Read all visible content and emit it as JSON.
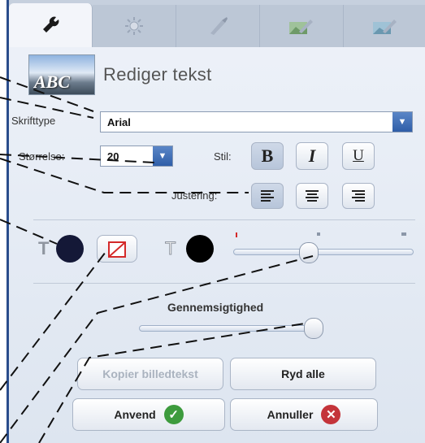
{
  "tabs": [
    {
      "name": "wrench",
      "active": true
    },
    {
      "name": "brightness",
      "active": false
    },
    {
      "name": "brush",
      "active": false
    },
    {
      "name": "landscape-brush",
      "active": false
    },
    {
      "name": "image-brush",
      "active": false
    }
  ],
  "header": {
    "thumb_text": "ABC",
    "title": "Rediger tekst"
  },
  "font": {
    "label": "Skrifttype",
    "value": "Arial"
  },
  "size": {
    "label": "Størrelse:",
    "value": "20"
  },
  "style": {
    "label": "Stil:",
    "bold": "B",
    "italic": "I",
    "underline": "U",
    "bold_active": true
  },
  "justify": {
    "label": "Justering:",
    "active": "left"
  },
  "colors": {
    "text_color": "#141837",
    "bg_color": "#000000",
    "accent": "#2f5ea8",
    "none_red": "#d42a2a"
  },
  "opacity": {
    "label": "Gennemsigtighed",
    "value": 0.97
  },
  "shadow_slider": {
    "value": 0.42
  },
  "buttons": {
    "copy": "Kopier billedtekst",
    "clear": "Ryd alle",
    "apply": "Anvend",
    "cancel": "Annuller"
  },
  "icons": {
    "apply": "check-icon",
    "cancel": "x-icon"
  }
}
